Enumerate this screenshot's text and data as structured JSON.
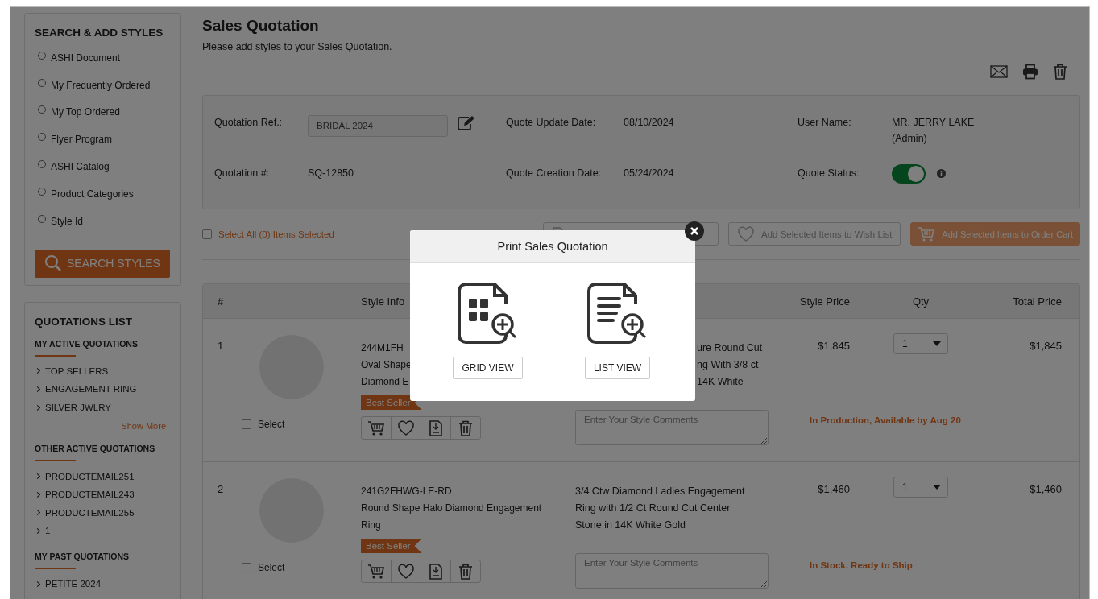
{
  "sidebar": {
    "search_panel": {
      "title": "SEARCH & ADD STYLES",
      "options": [
        {
          "label": "ASHI Document",
          "selected": false
        },
        {
          "label": "My Frequently Ordered",
          "selected": false
        },
        {
          "label": "My Top Ordered",
          "selected": false
        },
        {
          "label": "Flyer Program",
          "selected": false
        },
        {
          "label": "ASHI Catalog",
          "selected": false
        },
        {
          "label": "Product Categories",
          "selected": false
        },
        {
          "label": "Style Id",
          "selected": false
        }
      ],
      "button": "SEARCH STYLES"
    },
    "quotations": {
      "title": "QUOTATIONS LIST",
      "sections": [
        {
          "title": "MY ACTIVE QUOTATIONS",
          "items": [
            "TOP SELLERS",
            "ENGAGEMENT RING",
            "SILVER JWLRY"
          ],
          "show_more": "Show More"
        },
        {
          "title": "OTHER ACTIVE QUOTATIONS",
          "items": [
            "PRODUCTEMAIL251",
            "PRODUCTEMAIL243",
            "PRODUCTEMAIL255",
            "1"
          ]
        },
        {
          "title": "MY PAST QUOTATIONS",
          "items": [
            "PETITE 2024"
          ]
        }
      ]
    }
  },
  "main": {
    "title": "Sales Quotation",
    "subtitle": "Please add styles to your Sales Quotation.",
    "details": {
      "ref_label": "Quotation Ref.:",
      "ref_value": "BRIDAL 2024",
      "number_label": "Quotation #:",
      "number": "SQ-12850",
      "update_label": "Quote Update Date:",
      "update_date": "08/10/2024",
      "creation_label": "Quote Creation Date:",
      "creation_date": "05/24/2024",
      "user_label": "User Name:",
      "user_name": "MR. JERRY LAKE",
      "user_role": "(Admin)",
      "status_label": "Quote Status:",
      "status_on": true
    },
    "toolbar": {
      "select_all": "Select All (0) Items Selected",
      "select_all_checked": false,
      "wish_list": "Add Selected Items to Wish List",
      "order_cart": "Add Selected Items to Order Cart"
    },
    "table": {
      "columns": [
        "#",
        "Style Info",
        "Style Price",
        "Qty",
        "Total Price"
      ],
      "rows": [
        {
          "index": "1",
          "style_lines": [
            "244M1FH",
            "Oval Shape",
            "Diamond E"
          ],
          "badge": "Best Seller",
          "select_label": "Select",
          "selected": false,
          "description_lines": [
            "ure Round Cut",
            "ng With 3/8 ct",
            "14K White"
          ],
          "comment_placeholder": "Enter Your Style Comments",
          "availability": "In Production, Available by Aug 20",
          "price": "$1,845",
          "qty": "1",
          "total": "$1,845"
        },
        {
          "index": "2",
          "style_lines": [
            "241G2FHWG-LE-RD",
            "Round Shape Halo Diamond Engagement",
            "Ring"
          ],
          "badge": "Best Seller",
          "select_label": "Select",
          "selected": false,
          "description_lines": [
            "3/4 Ctw Diamond Ladies Engagement",
            "Ring with 1/2 Ct Round Cut Center",
            "Stone in 14K White Gold"
          ],
          "comment_placeholder": "Enter Your Style Comments",
          "availability": "In Stock, Ready to Ship",
          "price": "$1,460",
          "qty": "1",
          "total": "$1,460"
        }
      ]
    }
  },
  "modal": {
    "title": "Print Sales Quotation",
    "options": [
      {
        "kind": "grid",
        "label": "GRID VIEW"
      },
      {
        "kind": "list",
        "label": "LIST VIEW"
      }
    ]
  }
}
